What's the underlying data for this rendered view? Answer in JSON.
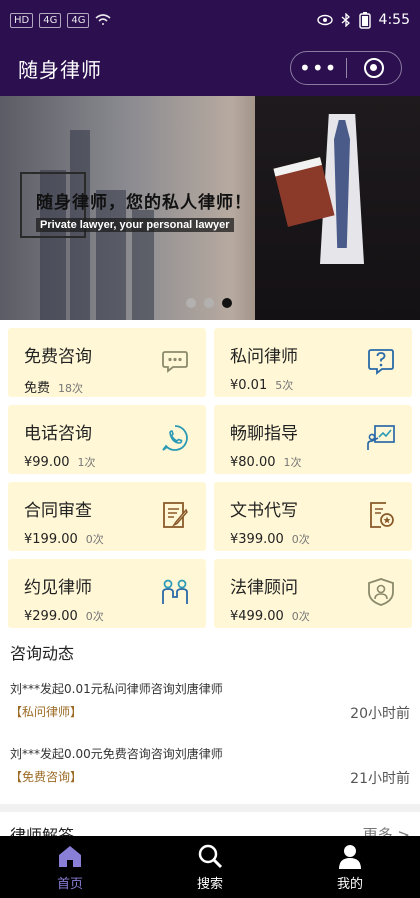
{
  "status_bar": {
    "left_badges": [
      "HD",
      "4G",
      "4G"
    ],
    "time": "4:55"
  },
  "header": {
    "title": "随身律师",
    "more_label": "•••"
  },
  "banner": {
    "title": "随身律师，您的私人律师！",
    "subtitle": "Private lawyer, your personal lawyer",
    "slide_count": 3,
    "active_slide": 3
  },
  "services": [
    {
      "name": "免费咨询",
      "price": "免费",
      "count": "18次",
      "icon": "chat-bubble-icon"
    },
    {
      "name": "私问律师",
      "price": "¥0.01",
      "count": "5次",
      "icon": "question-icon"
    },
    {
      "name": "电话咨询",
      "price": "¥99.00",
      "count": "1次",
      "icon": "phone-icon"
    },
    {
      "name": "畅聊指导",
      "price": "¥80.00",
      "count": "1次",
      "icon": "teacher-board-icon"
    },
    {
      "name": "合同审查",
      "price": "¥199.00",
      "count": "0次",
      "icon": "contract-pen-icon"
    },
    {
      "name": "文书代写",
      "price": "¥399.00",
      "count": "0次",
      "icon": "document-seal-icon"
    },
    {
      "name": "约见律师",
      "price": "¥299.00",
      "count": "0次",
      "icon": "meeting-people-icon"
    },
    {
      "name": "法律顾问",
      "price": "¥499.00",
      "count": "0次",
      "icon": "shield-person-icon"
    }
  ],
  "news": {
    "title": "咨询动态",
    "items": [
      {
        "text": "刘***发起0.01元私问律师咨询刘唐律师",
        "tag": "【私问律师】",
        "time": "20小时前"
      },
      {
        "text": "刘***发起0.00元免费咨询咨询刘唐律师",
        "tag": "【免费咨询】",
        "time": "21小时前"
      }
    ]
  },
  "answers": {
    "title": "律师解答",
    "more": "更多 >"
  },
  "nav": [
    {
      "label": "首页",
      "icon": "home-icon",
      "active": true
    },
    {
      "label": "搜索",
      "icon": "search-icon",
      "active": false
    },
    {
      "label": "我的",
      "icon": "user-icon",
      "active": false
    }
  ],
  "colors": {
    "header_bg": "#2b0f4f",
    "card_bg": "#fff7d6",
    "tag_color": "#9b6b25",
    "nav_active": "#8a7fd6",
    "icon_gray": "#8b8b6b",
    "icon_blue": "#2a6aa8",
    "icon_teal": "#2a9ab5",
    "icon_brown": "#8a5a2a"
  }
}
